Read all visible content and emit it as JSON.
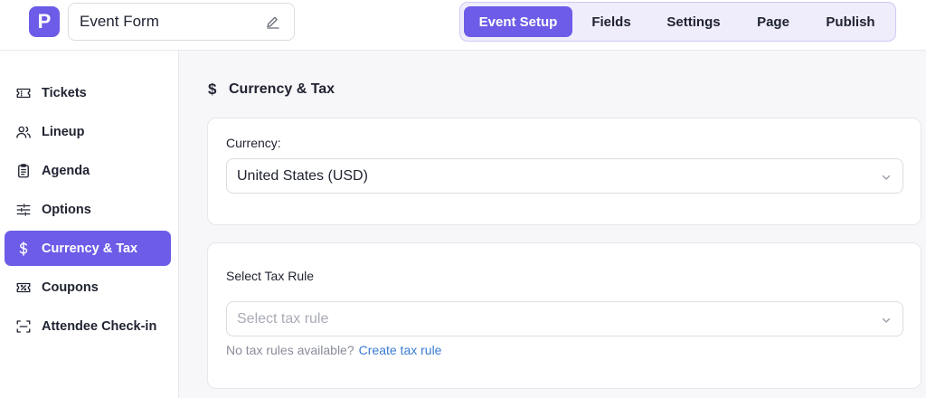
{
  "header": {
    "logo_letter": "P",
    "form_title": "Event Form",
    "tabs": [
      {
        "label": "Event Setup",
        "active": true
      },
      {
        "label": "Fields",
        "active": false
      },
      {
        "label": "Settings",
        "active": false
      },
      {
        "label": "Page",
        "active": false
      },
      {
        "label": "Publish",
        "active": false
      }
    ]
  },
  "sidebar": {
    "items": [
      {
        "label": "Tickets",
        "icon": "ticket-icon"
      },
      {
        "label": "Lineup",
        "icon": "users-icon"
      },
      {
        "label": "Agenda",
        "icon": "clipboard-icon"
      },
      {
        "label": "Options",
        "icon": "sliders-icon"
      },
      {
        "label": "Currency & Tax",
        "icon": "dollar-icon",
        "active": true
      },
      {
        "label": "Coupons",
        "icon": "coupon-icon"
      },
      {
        "label": "Attendee Check-in",
        "icon": "scan-icon"
      }
    ]
  },
  "main": {
    "section_title": "Currency & Tax",
    "currency": {
      "label": "Currency:",
      "value": "United States (USD)"
    },
    "tax": {
      "label": "Select Tax Rule",
      "placeholder": "Select tax rule",
      "help_text": "No tax rules available?",
      "link_text": "Create tax rule"
    }
  },
  "colors": {
    "accent": "#6c5ce7",
    "link": "#3a7bd5"
  }
}
